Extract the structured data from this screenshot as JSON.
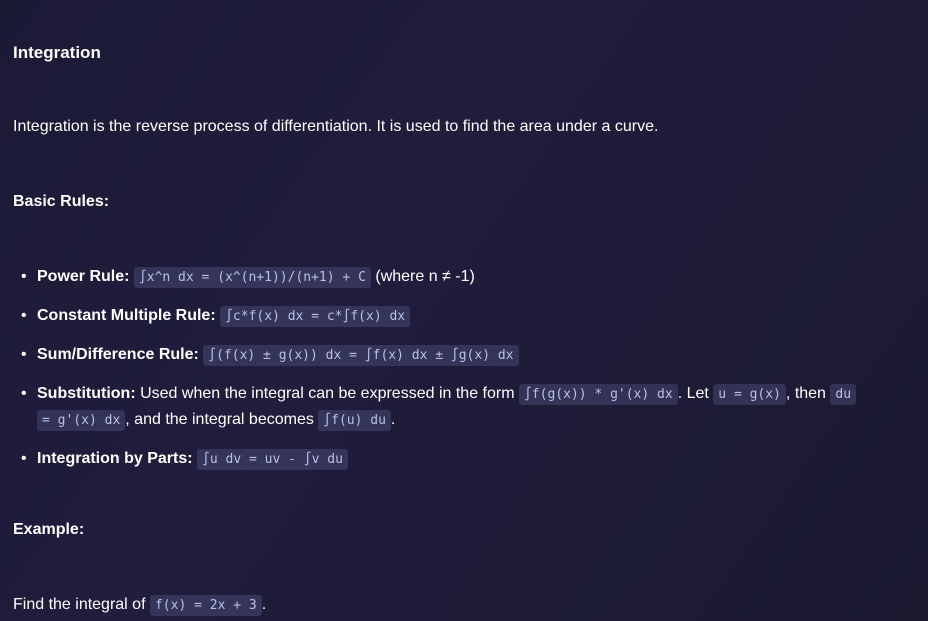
{
  "title": "Integration",
  "intro": "Integration is the reverse process of differentiation. It is used to find the area under a curve.",
  "basic_rules_heading": "Basic Rules:",
  "rules": [
    {
      "label": "Power Rule:",
      "code": "∫x^n dx = (x^(n+1))/(n+1) + C",
      "suffix": "(where n ≠ -1)"
    },
    {
      "label": "Constant Multiple Rule:",
      "code": "∫c*f(x) dx = c*∫f(x) dx"
    },
    {
      "label": "Sum/Difference Rule:",
      "code": "∫(f(x) ± g(x)) dx = ∫f(x) dx ± ∫g(x) dx"
    },
    {
      "label": "Substitution:",
      "text1": "Used when the integral can be expressed in the form",
      "code1": "∫f(g(x)) * g'(x) dx",
      "text2": ". Let",
      "code2": "u = g(x)",
      "text3": ", then",
      "code3a": "du",
      "code3b": "= g'(x) dx",
      "text4": ", and the integral becomes",
      "code4": "∫f(u) du",
      "text5": "."
    },
    {
      "label": "Integration by Parts:",
      "code": "∫u dv = uv - ∫v du"
    }
  ],
  "example_heading": "Example:",
  "example_text": "Find the integral of",
  "example_code": "f(x) = 2x + 3",
  "example_end": "."
}
